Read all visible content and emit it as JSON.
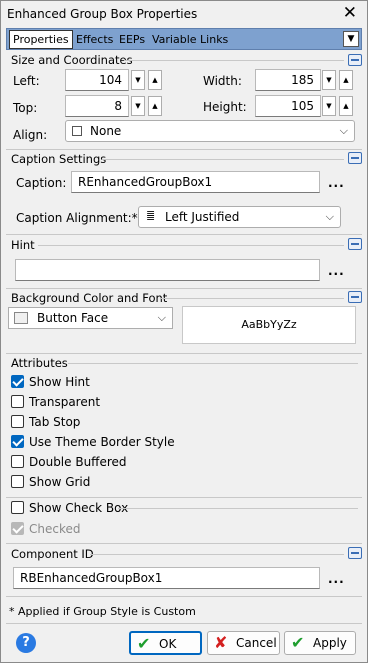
{
  "window": {
    "title": "Enhanced Group Box Properties",
    "close_glyph": "✕"
  },
  "tabs": [
    {
      "label": "Properties",
      "active": true
    },
    {
      "label": "Effects"
    },
    {
      "label": "EEPs"
    },
    {
      "label": "Variable Links"
    }
  ],
  "size": {
    "title": "Size and Coordinates",
    "left_label": "Left:",
    "left_value": "104",
    "width_label": "Width:",
    "width_value": "185",
    "top_label": "Top:",
    "top_value": "8",
    "height_label": "Height:",
    "height_value": "105",
    "align_label": "Align:",
    "align_value": "None"
  },
  "caption": {
    "title": "Caption Settings",
    "caption_label": "Caption:",
    "caption_value": "REnhancedGroupBox1",
    "alignment_label": "Caption Alignment:*",
    "alignment_value": "Left Justified"
  },
  "hint": {
    "title": "Hint",
    "value": ""
  },
  "background": {
    "title": "Background Color and Font",
    "color_value": "Button Face",
    "font_preview": "AaBbYyZz"
  },
  "attributes": {
    "title": "Attributes",
    "items": [
      {
        "label": "Show Hint",
        "checked": true
      },
      {
        "label": "Transparent",
        "checked": false
      },
      {
        "label": "Tab Stop",
        "checked": false
      },
      {
        "label": "Use Theme Border Style",
        "checked": true
      },
      {
        "label": "Double Buffered",
        "checked": false
      },
      {
        "label": "Show Grid",
        "checked": false
      }
    ]
  },
  "checkbox_opts": {
    "show_check_box": "Show Check Box",
    "checked": "Checked"
  },
  "component": {
    "title": "Component ID",
    "value": "RBEnhancedGroupBox1"
  },
  "footnote": "* Applied if Group Style is Custom",
  "buttons": {
    "ok": "OK",
    "cancel": "Cancel",
    "apply": "Apply",
    "help": "?"
  },
  "colors": {
    "tab_strip": "#7ea1cf",
    "accent": "#0067c0",
    "ok_icon": "#1f9e2f",
    "cancel_icon": "#d42020"
  }
}
